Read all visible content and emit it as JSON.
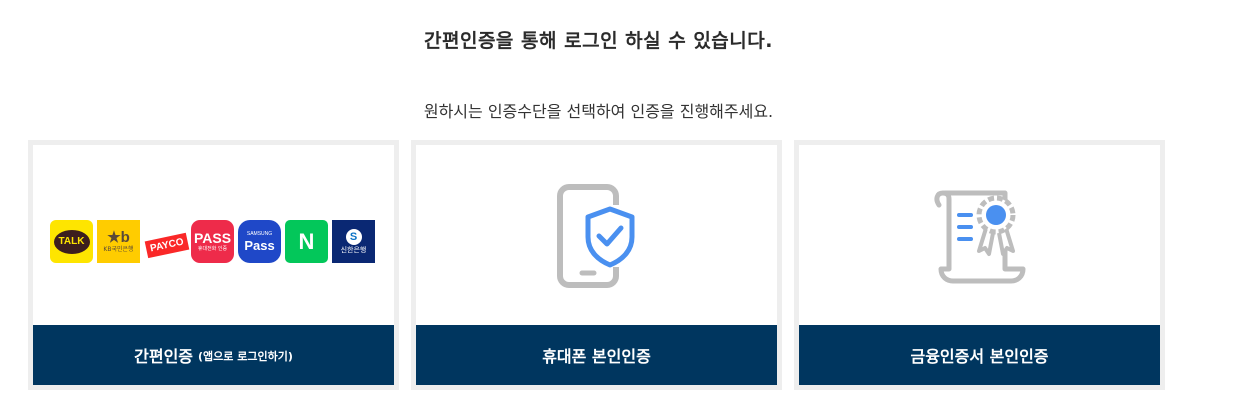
{
  "header": {
    "title": "간편인증을 통해 로그인 하실 수 있습니다.",
    "subtitle": "원하시는 인증수단을 선택하여 인증을 진행해주세요."
  },
  "cards": [
    {
      "label": "간편인증",
      "sub": "(앱으로 로그인하기)",
      "logos": [
        {
          "icon": "kakao-talk-icon",
          "text": "TALK"
        },
        {
          "icon": "kb-bank-icon",
          "text": "KB국민은행"
        },
        {
          "icon": "payco-icon",
          "text": "PAYCO"
        },
        {
          "icon": "pass-icon",
          "text": "PASS",
          "sub": "휴대전화 인증"
        },
        {
          "icon": "samsung-pass-icon",
          "text": "Pass",
          "sub": "SAMSUNG"
        },
        {
          "icon": "naver-icon",
          "text": "N"
        },
        {
          "icon": "shinhan-bank-icon",
          "text": "신한은행"
        }
      ]
    },
    {
      "label": "휴대폰 본인인증",
      "icon": "phone-shield-icon"
    },
    {
      "label": "금융인증서 본인인증",
      "icon": "certificate-icon"
    }
  ],
  "colors": {
    "footer": "#00365f",
    "border": "#eeeeee",
    "icon_gray": "#bdbdbd",
    "icon_blue": "#4a90f0"
  }
}
